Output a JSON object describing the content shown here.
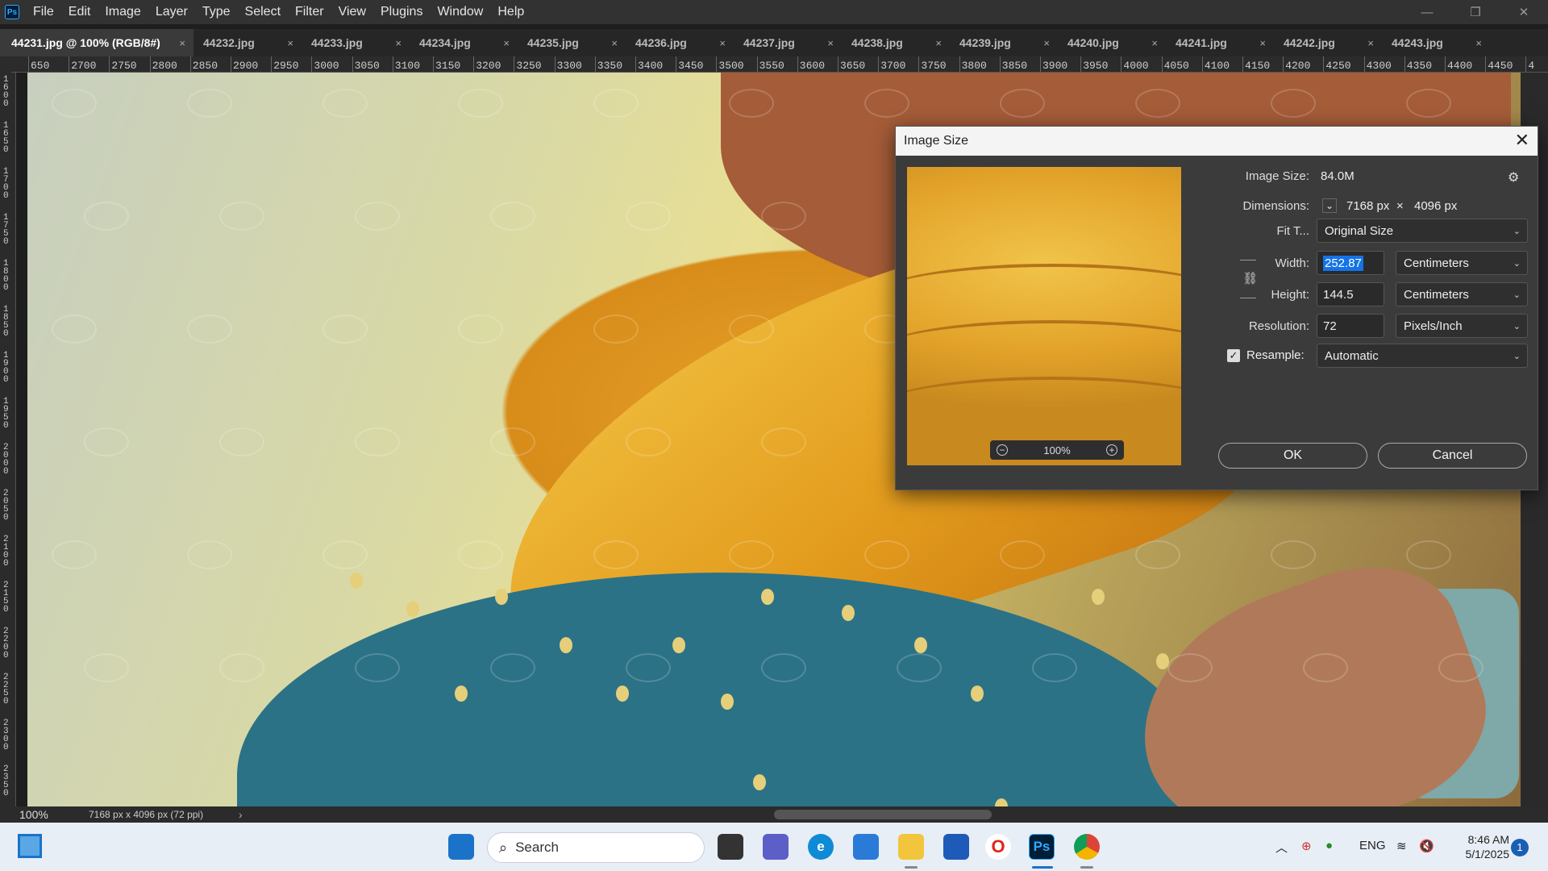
{
  "menubar": {
    "app_icon": "Ps",
    "items": [
      "File",
      "Edit",
      "Image",
      "Layer",
      "Type",
      "Select",
      "Filter",
      "View",
      "Plugins",
      "Window",
      "Help"
    ],
    "window_controls": {
      "minimize": "—",
      "restore": "❐",
      "close": "✕"
    }
  },
  "tabs": [
    {
      "label": "44231.jpg @ 100% (RGB/8#)",
      "active": true
    },
    {
      "label": "44232.jpg"
    },
    {
      "label": "44233.jpg"
    },
    {
      "label": "44234.jpg"
    },
    {
      "label": "44235.jpg"
    },
    {
      "label": "44236.jpg"
    },
    {
      "label": "44237.jpg"
    },
    {
      "label": "44238.jpg"
    },
    {
      "label": "44239.jpg"
    },
    {
      "label": "44240.jpg"
    },
    {
      "label": "44241.jpg"
    },
    {
      "label": "44242.jpg"
    },
    {
      "label": "44243.jpg"
    }
  ],
  "tab_close_glyph": "×",
  "ruler_top": [
    "650",
    "2700",
    "2750",
    "2800",
    "2850",
    "2900",
    "2950",
    "3000",
    "3050",
    "3100",
    "3150",
    "3200",
    "3250",
    "3300",
    "3350",
    "3400",
    "3450",
    "3500",
    "3550",
    "3600",
    "3650",
    "3700",
    "3750",
    "3800",
    "3850",
    "3900",
    "3950",
    "4000",
    "4050",
    "4100",
    "4150",
    "4200",
    "4250",
    "4300",
    "4350",
    "4400",
    "4450",
    "4"
  ],
  "ruler_left": [
    "1600",
    "1650",
    "1700",
    "1750",
    "1800",
    "1850",
    "1900",
    "1950",
    "2000",
    "2050",
    "2100",
    "2150",
    "2200",
    "2250",
    "2300",
    "2350"
  ],
  "status": {
    "zoom": "100%",
    "doc_info": "7168 px x 4096 px (72 ppi)",
    "arrow": "›"
  },
  "dialog": {
    "title": "Image Size",
    "close": "✕",
    "preview_zoom": "100%",
    "zoom_out": "−",
    "zoom_in": "+",
    "image_size_label": "Image Size:",
    "image_size_value": "84.0M",
    "gear": "⚙",
    "dimensions_label": "Dimensions:",
    "dimensions_width": "7168 px",
    "dimensions_x": "×",
    "dimensions_height": "4096 px",
    "fit_to_label": "Fit T...",
    "fit_to_value": "Original Size",
    "width_label": "Width:",
    "width_value": "252.87",
    "width_unit": "Centimeters",
    "height_label": "Height:",
    "height_value": "144.5",
    "height_unit": "Centimeters",
    "resolution_label": "Resolution:",
    "resolution_value": "72",
    "resolution_unit": "Pixels/Inch",
    "resample_label": "Resample:",
    "resample_checked": true,
    "resample_value": "Automatic",
    "ok_label": "OK",
    "cancel_label": "Cancel"
  },
  "taskbar": {
    "search_placeholder": "Search",
    "lang": "ENG",
    "time": "8:46 AM",
    "date": "5/1/2025",
    "notifications": "1",
    "ps_icon": "Ps",
    "opera_icon": "O",
    "edge_icon": "e"
  }
}
